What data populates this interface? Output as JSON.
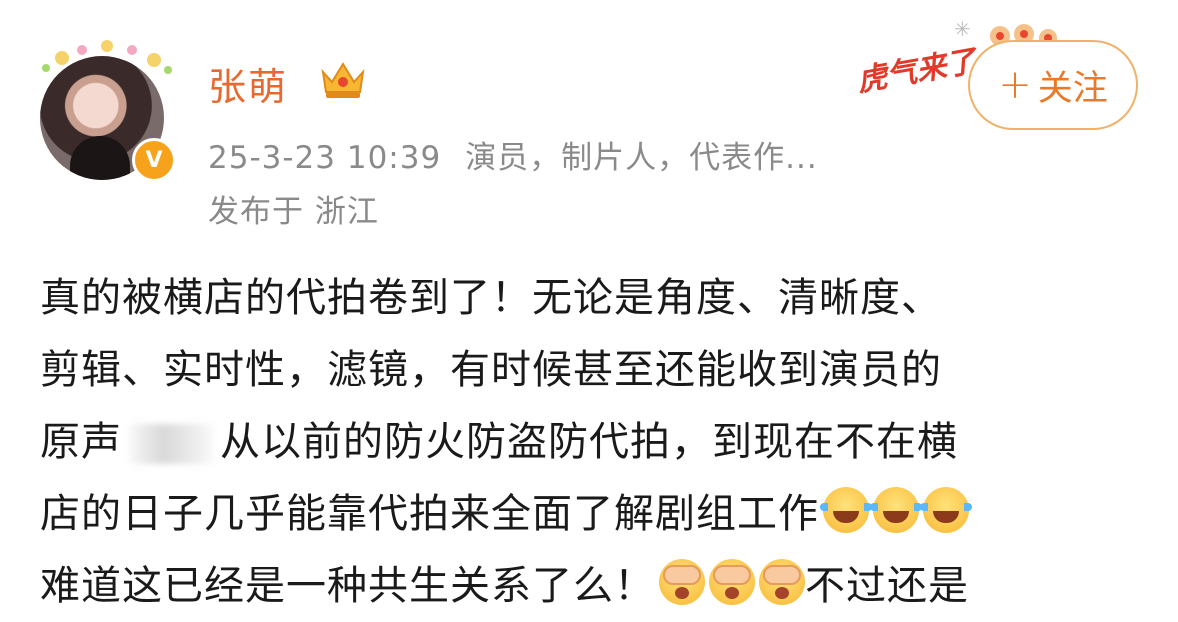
{
  "user": {
    "name": "张萌",
    "verified_icon": "verified-v-icon",
    "verified_glyph": "V",
    "crown_icon": "crown-icon"
  },
  "meta": {
    "timestamp": "25-3-23 10:39",
    "description": "演员，制片人，代表作...",
    "location": "发布于 浙江"
  },
  "decoration": {
    "text": "虎气来了"
  },
  "follow_button": {
    "plus": "+",
    "label": "关注"
  },
  "content": {
    "line1": "真的被横店的代拍卷到了！无论是角度、清晰度、",
    "line2": "剪辑、实时性，滤镜，有时候甚至还能收到演员的",
    "line3_a": "原声",
    "line3_b": "从以前的防火防盗防代拍，到现在不在横",
    "line4": "店的日子几乎能靠代拍来全面了解剧组工作",
    "line5_a": "难道这已经是一种共生关系了么！",
    "line5_b": "不过还是",
    "emoji_laugh": "laugh-cry-emoji",
    "emoji_cover": "face-cover-emoji"
  },
  "colors": {
    "name": "#e8692f",
    "meta": "#8a8a8a",
    "follow_border": "#f0b26a",
    "follow_text": "#e87a2a",
    "text": "#1a1a1a"
  }
}
